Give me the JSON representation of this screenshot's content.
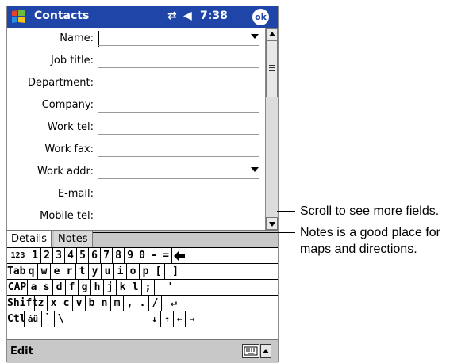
{
  "title_bar": {
    "app_title": "Contacts",
    "connectivity_symbol": "⇄",
    "speaker_symbol": "◀",
    "time": "7:38",
    "ok_label": "ok"
  },
  "form": {
    "fields": [
      {
        "label": "Name:",
        "has_dropdown": true
      },
      {
        "label": "Job title:",
        "has_dropdown": false
      },
      {
        "label": "Department:",
        "has_dropdown": false
      },
      {
        "label": "Company:",
        "has_dropdown": false
      },
      {
        "label": "Work tel:",
        "has_dropdown": false
      },
      {
        "label": "Work fax:",
        "has_dropdown": false
      },
      {
        "label": "Work addr:",
        "has_dropdown": true
      },
      {
        "label": "E-mail:",
        "has_dropdown": false
      },
      {
        "label": "Mobile tel:",
        "has_dropdown": false
      }
    ]
  },
  "tabs": [
    {
      "label": "Details"
    },
    {
      "label": "Notes"
    }
  ],
  "keyboard": {
    "rows": [
      [
        "123",
        "1",
        "2",
        "3",
        "4",
        "5",
        "6",
        "7",
        "8",
        "9",
        "0",
        "-",
        "=",
        "◆"
      ],
      [
        "Tab",
        "q",
        "w",
        "e",
        "r",
        "t",
        "y",
        "u",
        "i",
        "o",
        "p",
        "[",
        "]"
      ],
      [
        "CAP",
        "a",
        "s",
        "d",
        "f",
        "g",
        "h",
        "j",
        "k",
        "l",
        ";",
        "'"
      ],
      [
        "Shift",
        "z",
        "x",
        "c",
        "v",
        "b",
        "n",
        "m",
        ",",
        ".",
        "/",
        "↵"
      ],
      [
        "Ctl",
        "áü",
        "`",
        "\\",
        "",
        "↓",
        "↑",
        "←",
        "→"
      ]
    ]
  },
  "menu_bar": {
    "edit_label": "Edit"
  },
  "callouts": {
    "scroll_note": "Scroll to see more fields.",
    "notes_note_line1": "Notes is a good place for",
    "notes_note_line2": "maps and directions."
  },
  "colors": {
    "title_bar": "#1f45a8",
    "tab_bar": "#c8c8c8",
    "menu_bar": "#c8c8c8"
  },
  "icons": [
    "windows-start-icon",
    "connectivity-icon",
    "speaker-icon",
    "ok-button",
    "scroll-up-icon",
    "scroll-down-icon",
    "keyboard-icon",
    "input-selector-arrow-icon",
    "dropdown-arrow-icon"
  ]
}
